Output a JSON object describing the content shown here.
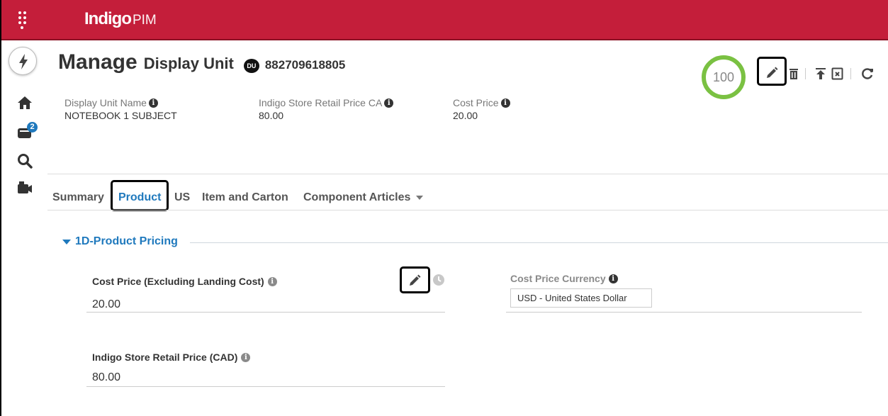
{
  "header": {
    "logo_brand": "Indigo",
    "logo_product": "PIM"
  },
  "rail": {
    "notification_count": "2"
  },
  "page": {
    "title_main": "Manage",
    "title_entity": "Display Unit",
    "entity_badge": "DU",
    "entity_code": "882709618805",
    "completeness_score": "100"
  },
  "attributes": [
    {
      "label": "Display Unit Name",
      "value": "NOTEBOOK 1 SUBJECT"
    },
    {
      "label": "Indigo Store Retail Price CA",
      "value": "80.00"
    },
    {
      "label": "Cost Price",
      "value": "20.00"
    }
  ],
  "tabs": [
    "Summary",
    "Product",
    "US",
    "Item and Carton",
    "Component Articles"
  ],
  "active_tab": "Product",
  "section": {
    "title": "1D-Product Pricing",
    "fields": [
      {
        "label": "Cost Price (Excluding Landing Cost)",
        "value": "20.00"
      },
      {
        "label": "Indigo Store Retail Price (CAD)",
        "value": "80.00"
      }
    ],
    "currency": {
      "label": "Cost Price Currency",
      "value": "USD - United States Dollar"
    }
  },
  "colors": {
    "brand_red": "#c41e3a",
    "accent_blue": "#1f79bd",
    "score_green": "#7ac142"
  },
  "icons": [
    "menu-dots-icon",
    "bolt-icon",
    "home-icon",
    "inbox-icon",
    "search-icon",
    "camera-icon",
    "info-icon",
    "pencil-icon",
    "trash-icon",
    "upload-icon",
    "export-icon",
    "refresh-icon",
    "history-icon",
    "caret-down-icon"
  ]
}
